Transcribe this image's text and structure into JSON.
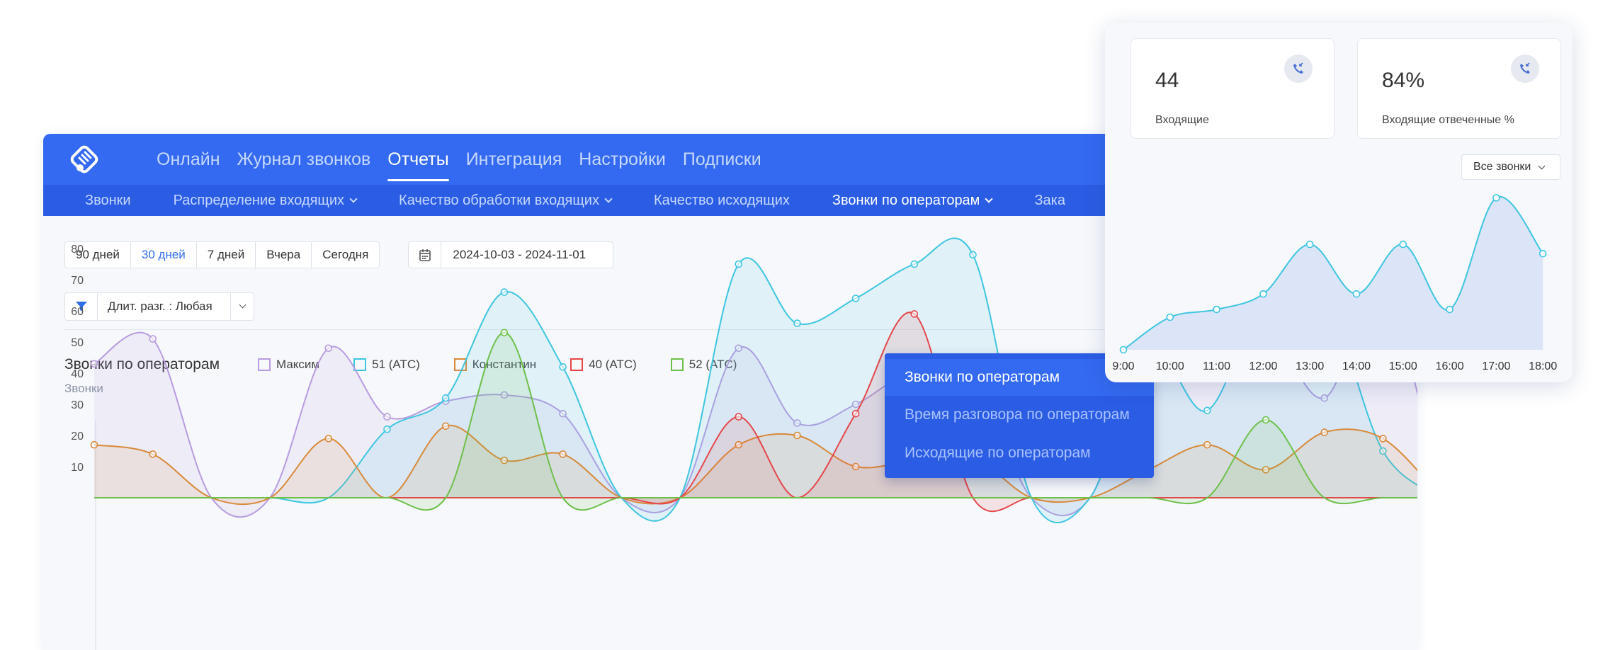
{
  "nav": {
    "items": [
      {
        "label": "Онлайн",
        "active": false
      },
      {
        "label": "Журнал звонков",
        "active": false
      },
      {
        "label": "Отчеты",
        "active": true
      },
      {
        "label": "Интеграция",
        "active": false
      },
      {
        "label": "Настройки",
        "active": false
      },
      {
        "label": "Подписки",
        "active": false
      }
    ]
  },
  "subnav": {
    "items": [
      {
        "label": "Звонки",
        "dropdown": false
      },
      {
        "label": "Распределение входящих",
        "dropdown": true
      },
      {
        "label": "Качество обработки входящих",
        "dropdown": true
      },
      {
        "label": "Качество исходящих",
        "dropdown": false
      },
      {
        "label": "Звонки по операторам",
        "dropdown": true,
        "active": true
      },
      {
        "label": "Зака",
        "dropdown": false
      }
    ]
  },
  "dropdown": {
    "items": [
      {
        "label": "Звонки по операторам",
        "active": true
      },
      {
        "label": "Время разговора по операторам",
        "active": false
      },
      {
        "label": "Исходящие по операторам",
        "active": false
      }
    ]
  },
  "periods": {
    "items": [
      "90 дней",
      "30 дней",
      "7 дней",
      "Вчера",
      "Сегодня"
    ],
    "selected": "30 дней"
  },
  "date_range": "2024-10-03 - 2024-11-01",
  "filter": {
    "label": "Длит. разг. : Любая"
  },
  "icons": {
    "logo": "phone-hand-logo-icon",
    "calendar": "calendar-icon",
    "filter": "filter-icon",
    "chevron": "chevron-down-icon",
    "phone": "incoming-call-icon"
  },
  "colors": {
    "primary": "#3469f1",
    "subbar": "#2b5ce4",
    "active_link": "#2f6fe5"
  },
  "chart": {
    "title": "Звонки по операторам",
    "ylabel": "Звонки"
  },
  "chart_data": [
    {
      "type": "area",
      "title": "Звонки по операторам",
      "ylabel": "Звонки",
      "xlabel": "",
      "ylim": [
        0,
        80
      ],
      "yticks": [
        10,
        20,
        30,
        40,
        50,
        60,
        70,
        80
      ],
      "grid": false,
      "legend": "top-left",
      "x": [
        1,
        2,
        3,
        4,
        5,
        6,
        7,
        8,
        9,
        10,
        11,
        12,
        13,
        14,
        15,
        16,
        17,
        18,
        19,
        20,
        21,
        22,
        23,
        24
      ],
      "series": [
        {
          "name": "Максим",
          "color": "#b89be0",
          "values": [
            43,
            51,
            0,
            0,
            48,
            26,
            31,
            33,
            27,
            0,
            0,
            48,
            24,
            30,
            41,
            40,
            0,
            0,
            51,
            49,
            55,
            32,
            67,
            0
          ]
        },
        {
          "name": "51 (АТС)",
          "color": "#3ec6e0",
          "values": [
            0,
            0,
            0,
            0,
            0,
            22,
            32,
            66,
            42,
            0,
            0,
            75,
            56,
            64,
            75,
            78,
            0,
            0,
            48,
            28,
            66,
            65,
            15,
            0
          ]
        },
        {
          "name": "Константин",
          "color": "#d88a3a",
          "values": [
            17,
            14,
            0,
            0,
            19,
            0,
            23,
            12,
            14,
            0,
            0,
            17,
            20,
            10,
            12,
            13,
            0,
            0,
            9,
            17,
            9,
            21,
            19,
            0
          ]
        },
        {
          "name": "40 (АТС)",
          "color": "#e5474b",
          "values": [
            0,
            0,
            0,
            0,
            0,
            0,
            0,
            0,
            0,
            0,
            0,
            26,
            0,
            27,
            59,
            0,
            0,
            0,
            0,
            0,
            0,
            0,
            0,
            0
          ]
        },
        {
          "name": "52 (АТС)",
          "color": "#6dc04a",
          "values": [
            0,
            0,
            0,
            0,
            0,
            0,
            0,
            53,
            0,
            0,
            0,
            0,
            0,
            0,
            0,
            0,
            0,
            0,
            0,
            0,
            25,
            0,
            0,
            0
          ]
        }
      ]
    },
    {
      "type": "area",
      "title": "",
      "xlabel": "",
      "ylabel": "",
      "categories": [
        "9:00",
        "10:00",
        "11:00",
        "12:00",
        "13:00",
        "14:00",
        "15:00",
        "16:00",
        "17:00",
        "18:00"
      ],
      "series": [
        {
          "values": [
            0,
            21,
            26,
            36,
            68,
            36,
            68,
            26,
            98,
            62
          ]
        }
      ],
      "ylim": [
        0,
        100
      ],
      "grid": false,
      "color": "#3ec6e0"
    }
  ],
  "stats": [
    {
      "value": "44",
      "label": "Входящие"
    },
    {
      "value": "84%",
      "label": "Входящие отвеченные %"
    }
  ],
  "select_all": {
    "label": "Все звонки"
  }
}
